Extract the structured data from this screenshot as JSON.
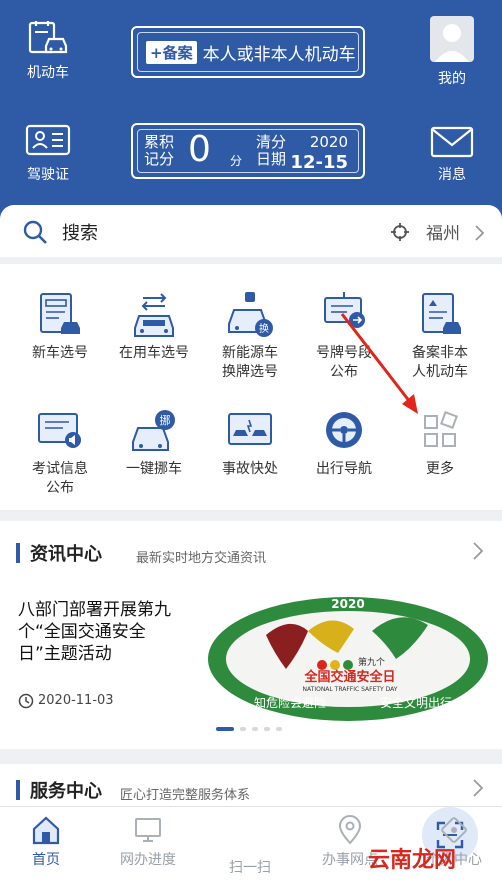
{
  "header": {
    "vehicle_label": "机动车",
    "license_label": "驾驶证",
    "plate_tag": "+备案",
    "plate_text": "本人或非本人机动车",
    "score_label": "累积记分",
    "score_value": "0",
    "score_unit": "分",
    "clear_label": "清分日期",
    "clear_year": "2020",
    "clear_md": "12-15",
    "mine_label": "我的",
    "message_label": "消息"
  },
  "search": {
    "placeholder": "搜索",
    "city": "福州"
  },
  "grid": {
    "items": [
      {
        "label1": "新车选号",
        "label2": ""
      },
      {
        "label1": "在用车选号",
        "label2": ""
      },
      {
        "label1": "新能源车",
        "label2": "换牌选号"
      },
      {
        "label1": "号牌号段",
        "label2": "公布"
      },
      {
        "label1": "备案非本",
        "label2": "人机动车"
      },
      {
        "label1": "考试信息",
        "label2": "公布"
      },
      {
        "label1": "一键挪车",
        "label2": ""
      },
      {
        "label1": "事故快处",
        "label2": ""
      },
      {
        "label1": "出行导航",
        "label2": ""
      },
      {
        "label1": "更多",
        "label2": ""
      }
    ],
    "badge_swap": "换",
    "badge_move": "挪"
  },
  "news": {
    "title": "资讯中心",
    "subtitle": "最新实时地方交通资讯",
    "article_title": "八部门部署开展第九个“全国交通安全日”主题活动",
    "article_date": "2020-11-03",
    "image_year": "2020",
    "image_caption": "全国交通安全日",
    "image_caption_small": "第九个",
    "image_caption_en": "NATIONAL TRAFFIC SAFETY DAY",
    "image_slogan_left": "知危险会避险",
    "image_slogan_right": "安全文明出行"
  },
  "service": {
    "title": "服务中心",
    "subtitle": "匠心打造完整服务体系"
  },
  "tabs": [
    {
      "label": "首页"
    },
    {
      "label": "网办进度"
    },
    {
      "label": "扫一扫"
    },
    {
      "label": "办事网点"
    },
    {
      "label": "个人中心"
    }
  ],
  "watermark": "云南龙网",
  "colors": {
    "brand": "#2f5aa6",
    "accent_red": "#d6281e"
  }
}
